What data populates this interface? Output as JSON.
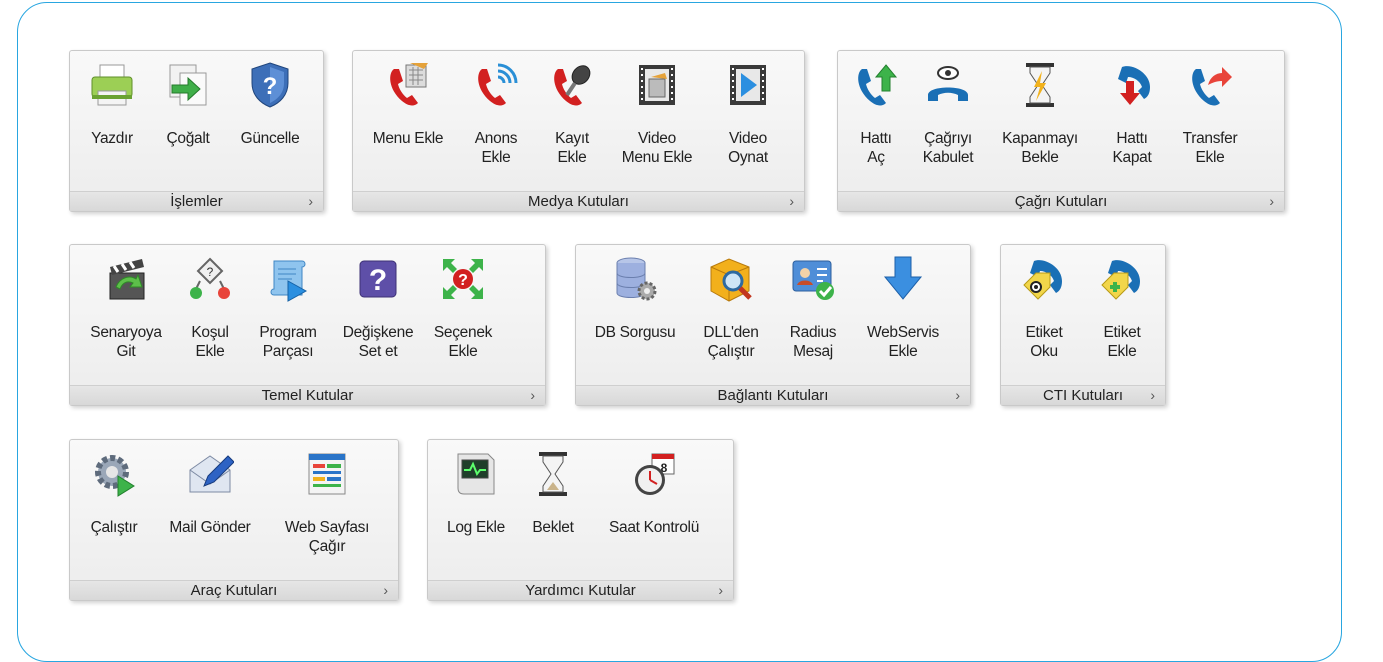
{
  "groups": [
    {
      "id": "islemler",
      "label": "İşlemler",
      "items": [
        {
          "label": "Yazdır",
          "icon": "printer-icon"
        },
        {
          "label": "Çoğalt",
          "icon": "copy-document-icon"
        },
        {
          "label": "Güncelle",
          "icon": "help-shield-icon"
        }
      ]
    },
    {
      "id": "medya",
      "label": "Medya Kutuları",
      "items": [
        {
          "label": "Menu Ekle",
          "icon": "phone-menu-icon"
        },
        {
          "label": "Anons\nEkle",
          "icon": "phone-broadcast-icon"
        },
        {
          "label": "Kayıt\nEkle",
          "icon": "phone-microphone-icon"
        },
        {
          "label": "Video\nMenu Ekle",
          "icon": "film-menu-icon"
        },
        {
          "label": "Video\nOynat",
          "icon": "film-play-icon"
        }
      ]
    },
    {
      "id": "cagri",
      "label": "Çağrı Kutuları",
      "items": [
        {
          "label": "Hattı\nAç",
          "icon": "phone-pickup-icon"
        },
        {
          "label": "Çağrıyı\nKabulet",
          "icon": "phone-accept-icon"
        },
        {
          "label": "Kapanmayı\nBekle",
          "icon": "hourglass-lightning-icon"
        },
        {
          "label": "Hattı\nKapat",
          "icon": "phone-hangup-icon"
        },
        {
          "label": "Transfer\nEkle",
          "icon": "phone-transfer-icon"
        }
      ]
    },
    {
      "id": "temel",
      "label": "Temel Kutular",
      "items": [
        {
          "label": "Senaryoya\nGit",
          "icon": "clapper-goto-icon"
        },
        {
          "label": "Koşul\nEkle",
          "icon": "condition-diamond-icon"
        },
        {
          "label": "Program\nParçası",
          "icon": "scroll-play-icon"
        },
        {
          "label": "Değişkene\nSet et",
          "icon": "variable-question-icon"
        },
        {
          "label": "Seçenek\nEkle",
          "icon": "choice-arrows-icon"
        }
      ]
    },
    {
      "id": "baglanti",
      "label": "Bağlantı Kutuları",
      "items": [
        {
          "label": "DB Sorgusu",
          "icon": "database-gear-icon"
        },
        {
          "label": "DLL'den\nÇalıştır",
          "icon": "box-search-icon"
        },
        {
          "label": "Radius\nMesaj",
          "icon": "id-card-check-icon"
        },
        {
          "label": "WebServis\nEkle",
          "icon": "download-arrow-icon"
        }
      ]
    },
    {
      "id": "cti",
      "label": "CTI Kutuları",
      "items": [
        {
          "label": "Etiket\nOku",
          "icon": "phone-tag-read-icon"
        },
        {
          "label": "Etiket\nEkle",
          "icon": "phone-tag-add-icon"
        }
      ]
    },
    {
      "id": "arac",
      "label": "Araç Kutuları",
      "items": [
        {
          "label": "Çalıştır",
          "icon": "gear-play-icon"
        },
        {
          "label": "Mail Gönder",
          "icon": "mail-pen-icon"
        },
        {
          "label": "Web Sayfası\nÇağır",
          "icon": "web-page-icon"
        }
      ]
    },
    {
      "id": "yardimci",
      "label": "Yardımcı Kutular",
      "items": [
        {
          "label": "Log Ekle",
          "icon": "log-monitor-icon"
        },
        {
          "label": "Beklet",
          "icon": "hourglass-icon"
        },
        {
          "label": "Saat Kontrolü",
          "icon": "clock-calendar-icon"
        }
      ]
    }
  ],
  "launcher_glyph": "›",
  "colors": {
    "frame": "#29a6e0",
    "phone_red": "#d22020",
    "phone_blue": "#1a6fb5"
  }
}
